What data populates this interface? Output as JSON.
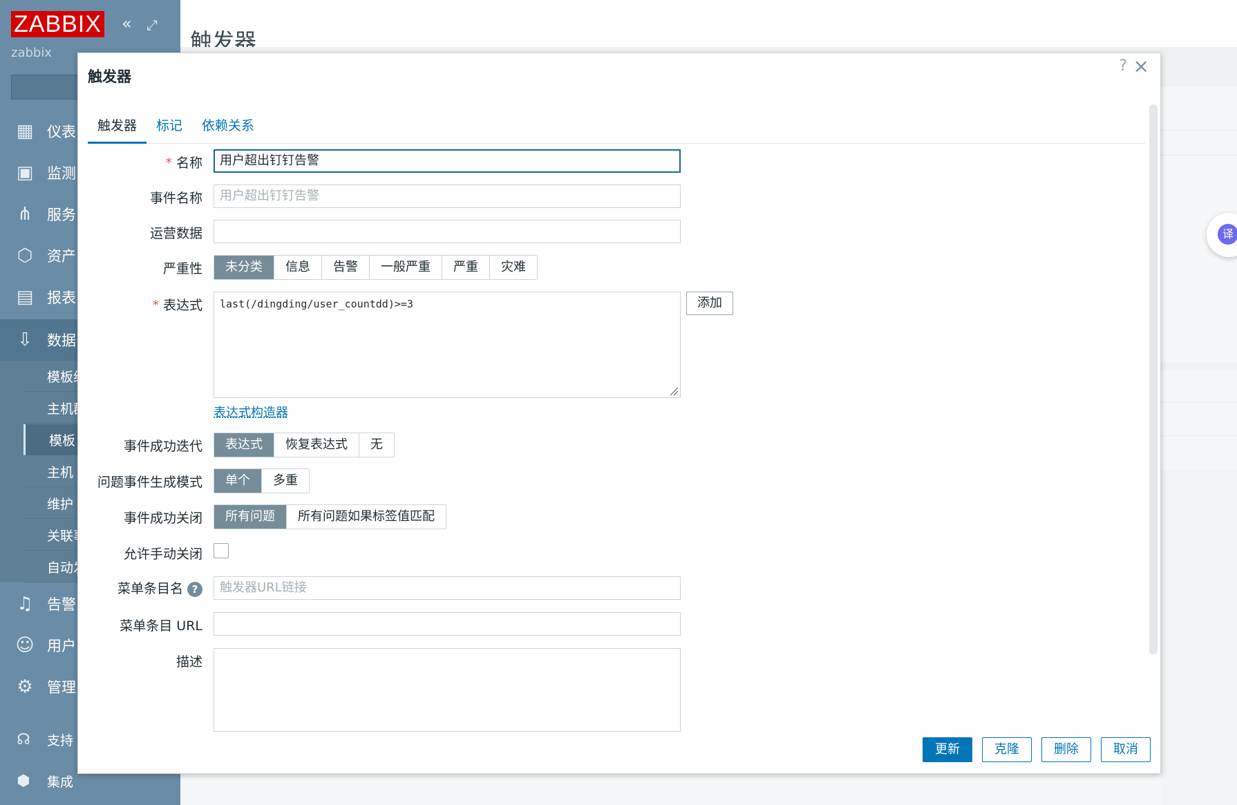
{
  "sidebar": {
    "logo": "ZABBIX",
    "username": "zabbix",
    "collapse_icon": "double-chevron-left-icon",
    "kiosk_icon": "kiosk-mode-icon",
    "nav": [
      {
        "label": "仪表",
        "icon": "dashboard-icon"
      },
      {
        "label": "监测",
        "icon": "monitoring-icon"
      },
      {
        "label": "服务",
        "icon": "services-icon"
      },
      {
        "label": "资产",
        "icon": "inventory-icon"
      },
      {
        "label": "报表",
        "icon": "reports-icon"
      },
      {
        "label": "数据",
        "icon": "data-collection-icon"
      }
    ],
    "submenu": [
      "模板组",
      "主机群",
      "模板",
      "主机",
      "维护",
      "关联事",
      "自动发"
    ],
    "nav2": [
      {
        "label": "告警",
        "icon": "alerts-icon"
      },
      {
        "label": "用户",
        "icon": "users-icon"
      },
      {
        "label": "管理",
        "icon": "administration-icon"
      }
    ],
    "bottom": [
      {
        "label": "支持",
        "icon": "support-icon"
      },
      {
        "label": "集成",
        "icon": "integrations-icon"
      }
    ]
  },
  "page": {
    "title": "触发器"
  },
  "modal": {
    "title": "触发器",
    "help": "?",
    "close": "×",
    "tabs": [
      "触发器",
      "标记",
      "依赖关系"
    ],
    "fields": {
      "name_label": "名称",
      "name_value": "用户超出钉钉告警",
      "event_name_label": "事件名称",
      "event_name_placeholder": "用户超出钉钉告警",
      "opdata_label": "运营数据",
      "severity_label": "严重性",
      "severity_options": [
        "未分类",
        "信息",
        "告警",
        "一般严重",
        "严重",
        "灾难"
      ],
      "expression_label": "表达式",
      "expression_value": "last(/dingding/user_countdd)>=3",
      "add_button": "添加",
      "expression_builder": "表达式构造器",
      "ok_event_label": "事件成功迭代",
      "ok_event_options": [
        "表达式",
        "恢复表达式",
        "无"
      ],
      "problem_mode_label": "问题事件生成模式",
      "problem_mode_options": [
        "单个",
        "多重"
      ],
      "ok_close_label": "事件成功关闭",
      "ok_close_options": [
        "所有问题",
        "所有问题如果标签值匹配"
      ],
      "manual_close_label": "允许手动关闭",
      "menu_name_label": "菜单条目名",
      "menu_name_placeholder": "触发器URL链接",
      "menu_url_label": "菜单条目 URL",
      "description_label": "描述"
    },
    "buttons": {
      "update": "更新",
      "clone": "克隆",
      "delete": "删除",
      "cancel": "取消"
    }
  },
  "translate_widget": "译"
}
